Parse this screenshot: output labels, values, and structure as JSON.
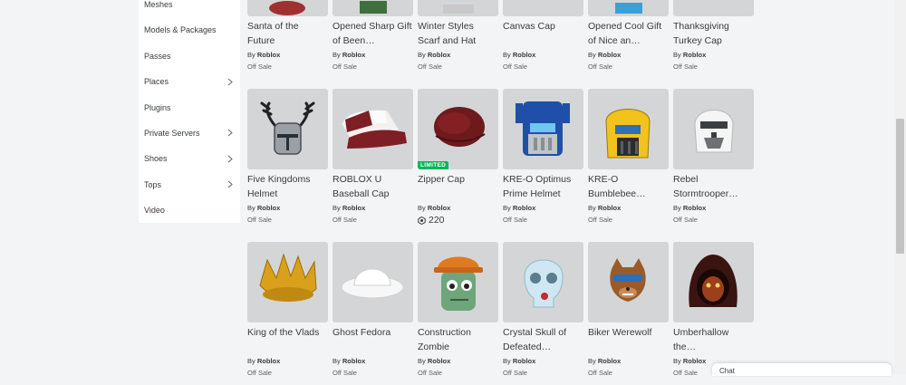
{
  "sidebar": {
    "items": [
      {
        "label": "Meshes",
        "chevron": false
      },
      {
        "label": "Models & Packages",
        "chevron": false
      },
      {
        "label": "Passes",
        "chevron": false
      },
      {
        "label": "Places",
        "chevron": true
      },
      {
        "label": "Plugins",
        "chevron": false
      },
      {
        "label": "Private Servers",
        "chevron": true
      },
      {
        "label": "Shoes",
        "chevron": true
      },
      {
        "label": "Tops",
        "chevron": true
      },
      {
        "label": "Video",
        "chevron": false
      }
    ]
  },
  "items": [
    {
      "name": "Santa of the Future",
      "creator_prefix": "By",
      "creator": "Roblox",
      "price": "Off Sale"
    },
    {
      "name": "Opened Sharp Gift of Been…",
      "creator_prefix": "By",
      "creator": "Roblox",
      "price": "Off Sale"
    },
    {
      "name": "Winter Styles Scarf and Hat",
      "creator_prefix": "By",
      "creator": "Roblox",
      "price": "Off Sale"
    },
    {
      "name": "Canvas Cap",
      "creator_prefix": "By",
      "creator": "Roblox",
      "price": "Off Sale"
    },
    {
      "name": "Opened Cool Gift of Nice an…",
      "creator_prefix": "By",
      "creator": "Roblox",
      "price": "Off Sale"
    },
    {
      "name": "Thanksgiving Turkey Cap",
      "creator_prefix": "By",
      "creator": "Roblox",
      "price": "Off Sale"
    },
    {
      "name": "Five Kingdoms Helmet",
      "creator_prefix": "By",
      "creator": "Roblox",
      "price": "Off Sale"
    },
    {
      "name": "ROBLOX U Baseball Cap",
      "creator_prefix": "By",
      "creator": "Roblox",
      "price": "Off Sale"
    },
    {
      "name": "Zipper Cap",
      "creator_prefix": "By",
      "creator": "Roblox",
      "price": "220",
      "badge": "LIMITED"
    },
    {
      "name": "KRE-O Optimus Prime Helmet",
      "creator_prefix": "By",
      "creator": "Roblox",
      "price": "Off Sale"
    },
    {
      "name": "KRE-O Bumblebee…",
      "creator_prefix": "By",
      "creator": "Roblox",
      "price": "Off Sale"
    },
    {
      "name": "Rebel Stormtrooper…",
      "creator_prefix": "By",
      "creator": "Roblox",
      "price": "Off Sale"
    },
    {
      "name": "King of the Vlads",
      "creator_prefix": "By",
      "creator": "Roblox",
      "price": "Off Sale"
    },
    {
      "name": "Ghost Fedora",
      "creator_prefix": "By",
      "creator": "Roblox",
      "price": "Off Sale"
    },
    {
      "name": "Construction Zombie",
      "creator_prefix": "By",
      "creator": "Roblox",
      "price": "Off Sale"
    },
    {
      "name": "Crystal Skull of Defeated…",
      "creator_prefix": "By",
      "creator": "Roblox",
      "price": "Off Sale"
    },
    {
      "name": "Biker Werewolf",
      "creator_prefix": "By",
      "creator": "Roblox",
      "price": "Off Sale"
    },
    {
      "name": "Umberhallow the…",
      "creator_prefix": "By",
      "creator": "Roblox",
      "price": "Off Sale"
    }
  ],
  "chat": {
    "label": "Chat"
  },
  "colors": {
    "limited_badge": "#02b757",
    "thumb_bg": "#d4d5d6",
    "page_bg": "#f2f4f5"
  }
}
